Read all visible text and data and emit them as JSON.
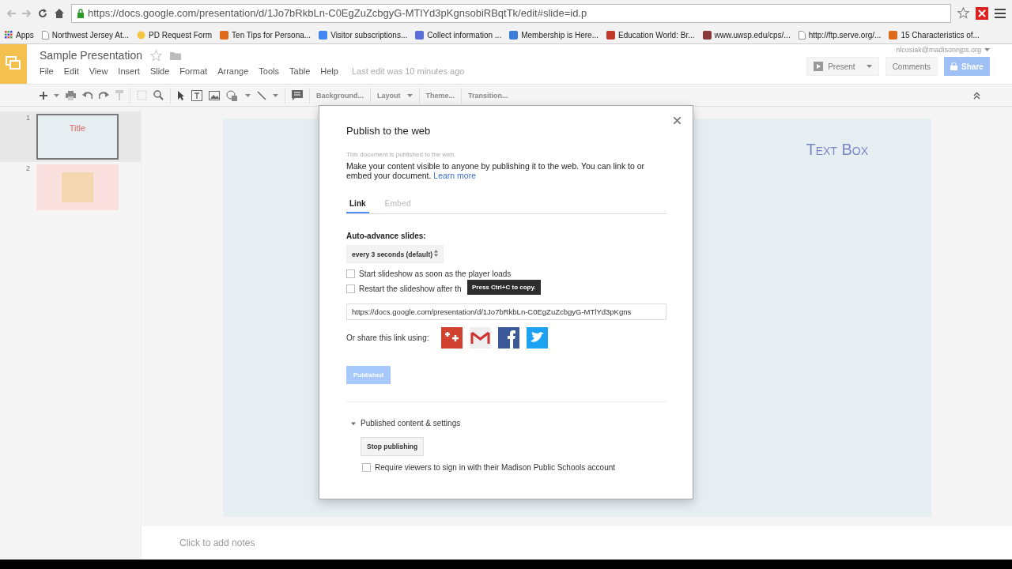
{
  "browser": {
    "url": "https://docs.google.com/presentation/d/1Jo7bRkbLn-C0EgZuZcbgyG-MTlYd3pKgnsobiRBqtTk/edit#slide=id.p",
    "bookmarks": [
      {
        "label": "Apps",
        "kind": "apps"
      },
      {
        "label": "Northwest Jersey At...",
        "kind": "page"
      },
      {
        "label": "PD Request Form",
        "kind": "dot"
      },
      {
        "label": "Ten Tips for Persona...",
        "kind": "edu"
      },
      {
        "label": "Visitor subscriptions...",
        "kind": "g"
      },
      {
        "label": "Collect information ...",
        "kind": "form"
      },
      {
        "label": "Membership is Here...",
        "kind": "w"
      },
      {
        "label": "Education World: Br...",
        "kind": "ew"
      },
      {
        "label": "www.uwsp.edu/cps/...",
        "kind": "globe"
      },
      {
        "label": "http://ftp.serve.org/...",
        "kind": "page"
      },
      {
        "label": "15 Characteristics of...",
        "kind": "edu"
      }
    ]
  },
  "app": {
    "title": "Sample Presentation",
    "user": "nlcosiak@madisonnjps.org",
    "menu": [
      "File",
      "Edit",
      "View",
      "Insert",
      "Slide",
      "Format",
      "Arrange",
      "Tools",
      "Table",
      "Help"
    ],
    "last_edit": "Last edit was 10 minutes ago",
    "present": "Present",
    "comments": "Comments",
    "share": "Share",
    "toolbar": [
      "Background...",
      "Layout",
      "Theme...",
      "Transition..."
    ]
  },
  "slides": [
    {
      "number": "1",
      "selected": true,
      "kind": "title",
      "title": "Title"
    },
    {
      "number": "2",
      "selected": false,
      "kind": "image"
    }
  ],
  "slide": {
    "text_box": "Text Box"
  },
  "notes": {
    "placeholder": "Click to add notes"
  },
  "dialog": {
    "title": "Publish to the web",
    "status": "This document is published to the web.",
    "description": "Make your content visible to anyone by publishing it to the web. You can link to or embed your document.",
    "learn_more": "Learn more",
    "tabs": [
      {
        "label": "Link",
        "selected": true
      },
      {
        "label": "Embed",
        "selected": false
      }
    ],
    "auto_advance_label": "Auto-advance slides:",
    "auto_advance_value": "every 3 seconds (default)",
    "options": [
      {
        "label": "Start slideshow as soon as the player loads",
        "checked": false
      },
      {
        "label": "Restart the slideshow after th",
        "checked": false
      }
    ],
    "tooltip": "Press Ctrl+C to copy.",
    "link": "https://docs.google.com/presentation/d/1Jo7bRkbLn-C0EgZuZcbgyG-MTlYd3pKgns",
    "share_label": "Or share this link using:",
    "share_targets": [
      {
        "kind": "gplus"
      },
      {
        "kind": "gmail"
      },
      {
        "kind": "facebook"
      },
      {
        "kind": "twitter"
      }
    ],
    "publish_button": {
      "label": "Published",
      "disabled": true
    },
    "settings": {
      "label": "Published content & settings",
      "expanded": true,
      "stop_button": "Stop publishing",
      "require_signin": {
        "label": "Require viewers to sign in with their Madison Public Schools account",
        "checked": false
      }
    }
  }
}
